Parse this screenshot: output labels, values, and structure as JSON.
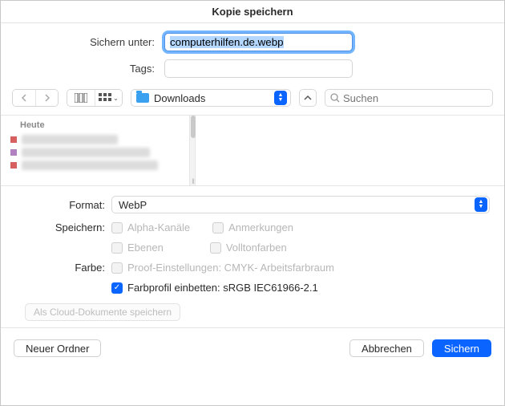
{
  "title": "Kopie speichern",
  "labels": {
    "save_as": "Sichern unter:",
    "tags": "Tags:",
    "format": "Format:",
    "save_opts": "Speichern:",
    "color": "Farbe:"
  },
  "filename": "computerhilfen.de.webp",
  "tags_value": "",
  "folder": {
    "name": "Downloads"
  },
  "search": {
    "placeholder": "Suchen"
  },
  "browser": {
    "section_header": "Heute"
  },
  "format": {
    "selected": "WebP"
  },
  "checkboxes": {
    "alpha": "Alpha-Kanäle",
    "annotations": "Anmerkungen",
    "layers": "Ebenen",
    "spot": "Volltonfarben",
    "proof": "Proof-Einstellungen: CMYK- Arbeitsfarbraum",
    "embed_profile": "Farbprofil einbetten: sRGB IEC61966-2.1"
  },
  "cloud_button": "Als Cloud-Dokumente speichern",
  "footer": {
    "new_folder": "Neuer Ordner",
    "cancel": "Abbrechen",
    "save": "Sichern"
  }
}
